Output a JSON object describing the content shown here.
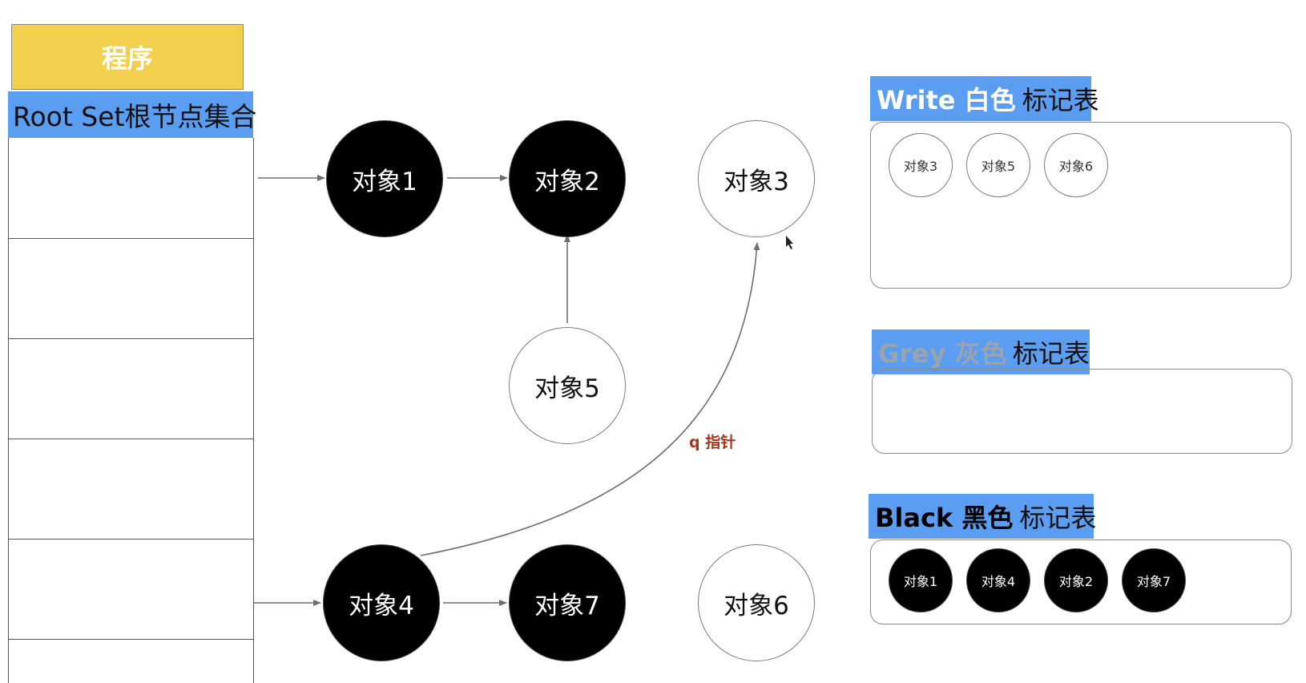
{
  "program": {
    "label": "程序"
  },
  "root_set": {
    "label": "Root Set根节点集合"
  },
  "nodes": {
    "obj1": "对象1",
    "obj2": "对象2",
    "obj3": "对象3",
    "obj4": "对象4",
    "obj5": "对象5",
    "obj6": "对象6",
    "obj7": "对象7"
  },
  "pointer_label": "q 指针",
  "tables": {
    "white": {
      "keyword": "Write 白色",
      "suffix": "标记表",
      "items": [
        "对象3",
        "对象5",
        "对象6"
      ]
    },
    "grey": {
      "keyword": "Grey 灰色",
      "suffix": "标记表",
      "items": []
    },
    "black": {
      "keyword": "Black 黑色",
      "suffix": "标记表",
      "items": [
        "对象1",
        "对象4",
        "对象2",
        "对象7"
      ]
    }
  },
  "colors": {
    "program_fill": "#f2d04e",
    "label_fill": "#5b9df1",
    "black_node": "#000000",
    "grey_text": "#9aa4ae",
    "pointer_text": "#a8341c"
  }
}
